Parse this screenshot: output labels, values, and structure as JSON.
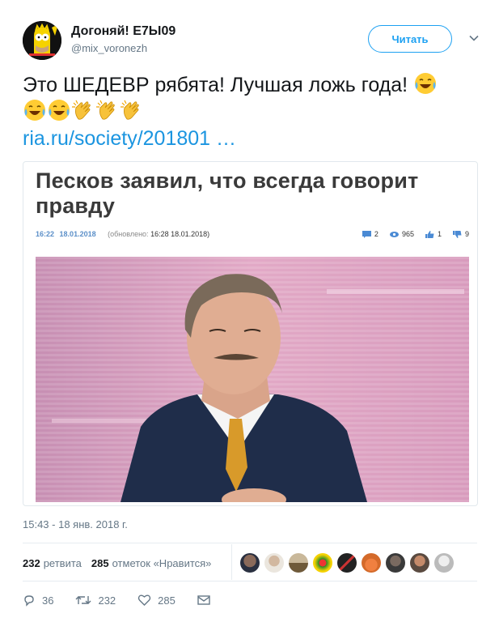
{
  "user": {
    "display_name": "Догоняй! E7Ы09",
    "handle": "@mix_voronezh",
    "avatar_icon": "simpson-avatar-icon"
  },
  "follow_button": {
    "label": "Читать"
  },
  "tweet": {
    "text": "Это ШЕДЕВР рябята! Лучшая ложь года!",
    "emojis_line1": [
      "face-with-tears-of-joy-emoji"
    ],
    "emojis_line2": [
      "face-with-tears-of-joy-emoji",
      "face-with-tears-of-joy-emoji",
      "clapping-hands-emoji",
      "clapping-hands-emoji",
      "clapping-hands-emoji"
    ],
    "link": "ria.ru/society/201801 …"
  },
  "card": {
    "title": "Песков заявил, что всегда говорит правду",
    "time": "16:22",
    "date": "18.01.2018",
    "updated_label": "(обновлено:",
    "updated_value": "16:28 18.01.2018)",
    "comments": "2",
    "views": "965",
    "likes": "1",
    "dislikes": "9"
  },
  "timestamp": "15:43 - 18 янв. 2018 г.",
  "engagement": {
    "retweets_count": "232",
    "retweets_label": "ретвита",
    "likes_count": "285",
    "likes_label": "отметок «Нравится»"
  },
  "actions": {
    "replies": "36",
    "retweets": "232",
    "likes": "285"
  },
  "colors": {
    "accent": "#1da1f2",
    "link": "#1b95e0",
    "muted": "#657786"
  }
}
